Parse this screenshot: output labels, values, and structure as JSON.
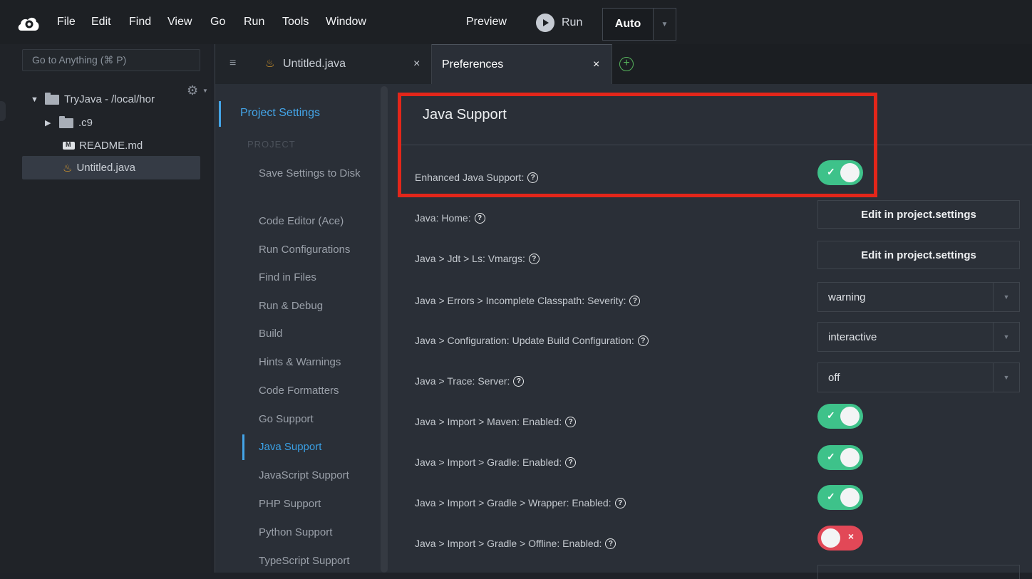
{
  "menubar": {
    "items": [
      "File",
      "Edit",
      "Find",
      "View",
      "Go",
      "Run",
      "Tools",
      "Window"
    ],
    "preview": "Preview",
    "run": "Run",
    "auto": "Auto"
  },
  "sidebar": {
    "goto_placeholder": "Go to Anything (⌘ P)",
    "tree": [
      {
        "label": "TryJava - /local/hor"
      },
      {
        "label": ".c9"
      },
      {
        "label": "README.md"
      },
      {
        "label": "Untitled.java"
      }
    ]
  },
  "tabs": [
    {
      "label": "Untitled.java"
    },
    {
      "label": "Preferences"
    }
  ],
  "nav": {
    "header": "Project Settings",
    "group": "PROJECT",
    "items": [
      "Save Settings to Disk",
      "Code Editor (Ace)",
      "Run Configurations",
      "Find in Files",
      "Run & Debug",
      "Build",
      "Hints & Warnings",
      "Code Formatters",
      "Go Support",
      "Java Support",
      "JavaScript Support",
      "PHP Support",
      "Python Support",
      "TypeScript Support"
    ],
    "active": "Java Support"
  },
  "section": {
    "title": "Java Support",
    "settings": [
      {
        "label": "Enhanced Java Support:",
        "control": "toggle",
        "value": "on"
      },
      {
        "label": "Java: Home:",
        "control": "button",
        "value": "Edit in project.settings"
      },
      {
        "label": "Java > Jdt > Ls: Vmargs:",
        "control": "button",
        "value": "Edit in project.settings"
      },
      {
        "label": "Java > Errors > Incomplete Classpath: Severity:",
        "control": "select",
        "value": "warning"
      },
      {
        "label": "Java > Configuration: Update Build Configuration:",
        "control": "select",
        "value": "interactive"
      },
      {
        "label": "Java > Trace: Server:",
        "control": "select",
        "value": "off"
      },
      {
        "label": "Java > Import > Maven: Enabled:",
        "control": "toggle",
        "value": "on"
      },
      {
        "label": "Java > Import > Gradle: Enabled:",
        "control": "toggle",
        "value": "on"
      },
      {
        "label": "Java > Import > Gradle > Wrapper: Enabled:",
        "control": "toggle",
        "value": "on"
      },
      {
        "label": "Java > Import > Gradle > Offline: Enabled:",
        "control": "toggle",
        "value": "off"
      }
    ]
  },
  "colors": {
    "accent": "#44a5e8",
    "toggle_on": "#3ec28a",
    "toggle_off": "#e24857",
    "highlight": "#e3261a"
  }
}
